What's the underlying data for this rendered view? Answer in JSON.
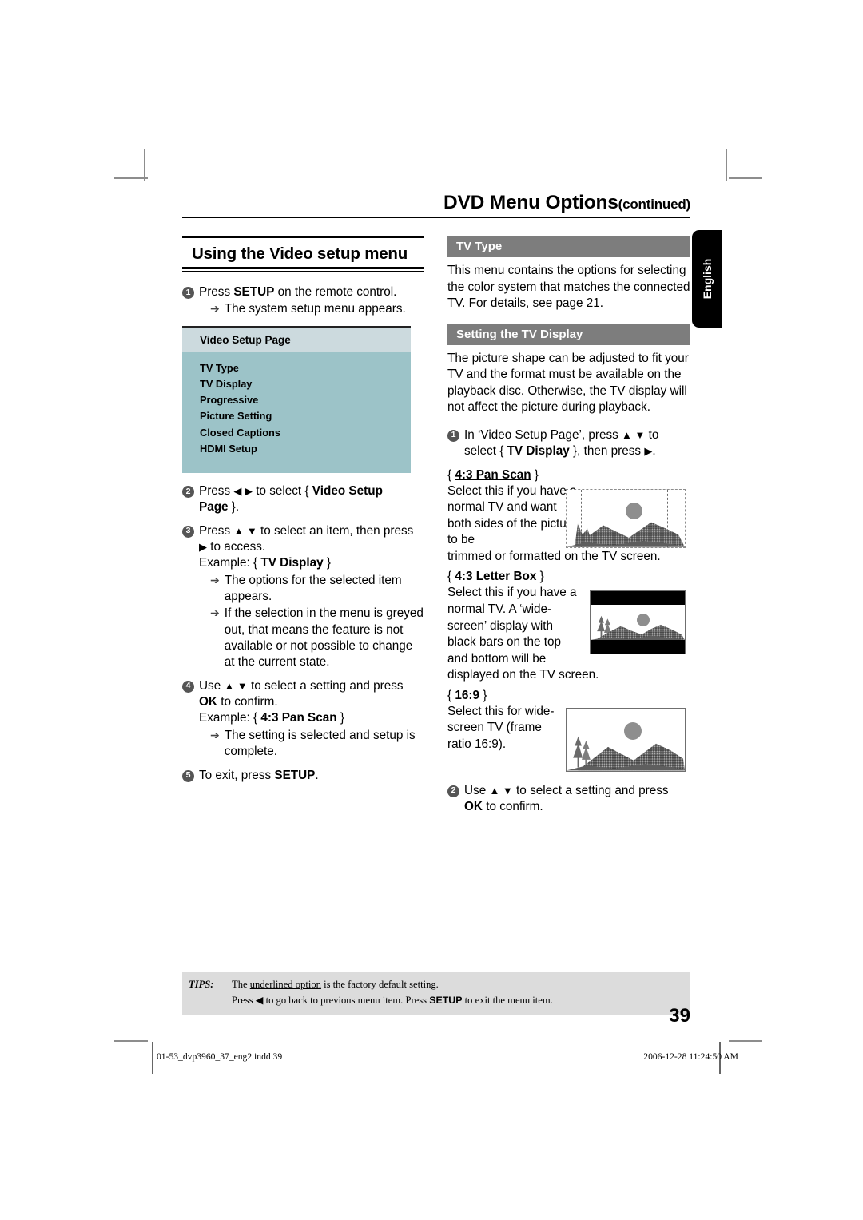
{
  "running_head": {
    "title": "DVD Menu Options",
    "continued": "(continued)"
  },
  "side_tab": {
    "label": "English"
  },
  "left_column": {
    "section_title": "Using the Video setup menu",
    "steps": [
      {
        "num": "1",
        "text_parts": [
          "Press ",
          "SETUP",
          " on the remote control."
        ],
        "subs": [
          {
            "marker": "➔",
            "text": "The system setup menu appears."
          }
        ]
      },
      {
        "num": "2",
        "line1": "Press ◀ ▶ to select { Video Setup",
        "line2": "Page }."
      },
      {
        "num": "3",
        "line1": "Press ▲ ▼ to select an item, then press",
        "line2": "▶ to access.",
        "line3": "Example: { TV Display }",
        "subs": [
          {
            "marker": "➔",
            "text": "The options for the selected item appears."
          },
          {
            "marker": "➔",
            "text": "If the selection in the menu is greyed out, that means the feature is not available or not possible to change at the current state."
          }
        ]
      },
      {
        "num": "4",
        "line1": "Use ▲ ▼ to select a setting and press",
        "line2": "OK to confirm.",
        "line3": "Example: { 4:3 Pan Scan }",
        "subs": [
          {
            "marker": "➔",
            "text": "The setting is selected and setup is complete."
          }
        ]
      },
      {
        "num": "5",
        "line1": "To exit, press SETUP."
      }
    ],
    "osd_menu": {
      "header": "Video Setup Page",
      "items": [
        "TV Type",
        "TV Display",
        "Progressive",
        "Picture Setting",
        "Closed Captions",
        "HDMI Setup"
      ]
    }
  },
  "right_column": {
    "tv_type": {
      "heading": "TV Type",
      "body": "This menu contains the options for selecting the color system that matches the connected TV. For details, see page 21."
    },
    "tv_display": {
      "heading": "Setting the TV Display",
      "body": "The picture shape can be adjusted to fit your TV and the format must be available on the playback disc. Otherwise, the TV display will not affect the picture during playback.",
      "step1": {
        "num": "1",
        "line1": "In ‘Video Setup Page’, press ▲ ▼ to",
        "line2_pre": "select { ",
        "line2_bold": "TV Display",
        "line2_post": " }, then press ▶."
      },
      "options": [
        {
          "open": "{ ",
          "name": "4:3 Pan Scan",
          "close": " }",
          "underlined": true,
          "narrow_text": "Select this if you have a normal TV and want both sides of the picture to be",
          "full_text": "trimmed or formatted on the TV screen.",
          "figure": "pan-scan-illustration"
        },
        {
          "open": "{ ",
          "name": "4:3 Letter Box",
          "close": " }",
          "underlined": false,
          "narrow_text": "Select this if you have a normal TV. A ‘wide-screen’ display with black bars on the top and bottom will be",
          "full_text": "displayed on the TV screen.",
          "figure": "letter-box-illustration"
        },
        {
          "open": "{ ",
          "name": "16:9",
          "close": " }",
          "underlined": false,
          "narrow_text": "Select this for wide-screen TV (frame ratio 16:9).",
          "full_text": "",
          "figure": "widescreen-illustration"
        }
      ],
      "step2": {
        "num": "2",
        "line1": "Use ▲ ▼ to select a setting and press",
        "line2_bold": "OK",
        "line2_post": " to confirm."
      }
    }
  },
  "tips": {
    "label": "TIPS:",
    "line1_pre": "The ",
    "line1_underline": "underlined option",
    "line1_post": " is the factory default setting.",
    "line2_pre": "Press  ◀ to go back to previous menu item. Press ",
    "line2_bold": "SETUP",
    "line2_post": " to exit the menu item."
  },
  "page_number": "39",
  "print_footer": {
    "filename": "01-53_dvp3960_37_eng2.indd   39",
    "timestamp": "2006-12-28   11:24:50 AM"
  }
}
